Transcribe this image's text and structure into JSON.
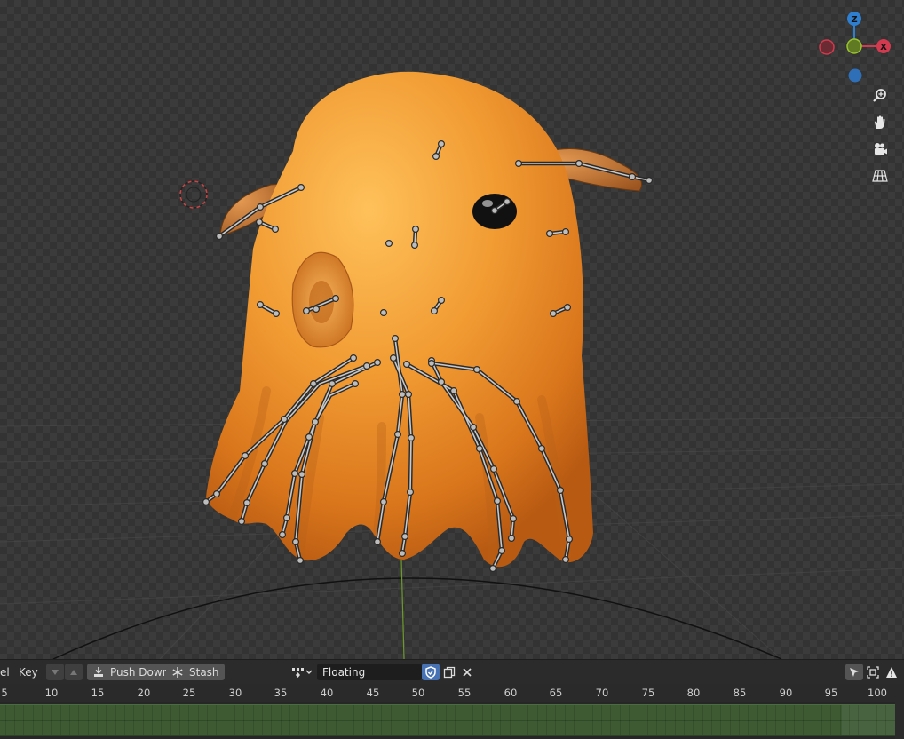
{
  "viewport": {
    "nav_gizmo": {
      "z_label": "Z",
      "x_label": "X"
    },
    "nav_buttons": [
      "zoom-icon",
      "hand-pan-icon",
      "camera-icon",
      "grid-perspective-icon"
    ]
  },
  "toolbar": {
    "editor_label_partial": "el",
    "key_menu": "Key",
    "push_down_label": "Push Down",
    "stash_label": "Stash",
    "action_name": "Floating",
    "right_icons": [
      "cursor-select-icon",
      "frame-icon",
      "warning-icon"
    ]
  },
  "timeline": {
    "frame_ticks": [
      "5",
      "10",
      "15",
      "20",
      "25",
      "30",
      "35",
      "40",
      "45",
      "50",
      "55",
      "60",
      "65",
      "70",
      "75",
      "80",
      "85",
      "90",
      "95",
      "100"
    ]
  },
  "colors": {
    "axis_x": "#d23b4f",
    "axis_y": "#8db428",
    "axis_z": "#2f7fd0",
    "creature_orange": "#e9892a",
    "strip_green": "#3d5a33"
  }
}
